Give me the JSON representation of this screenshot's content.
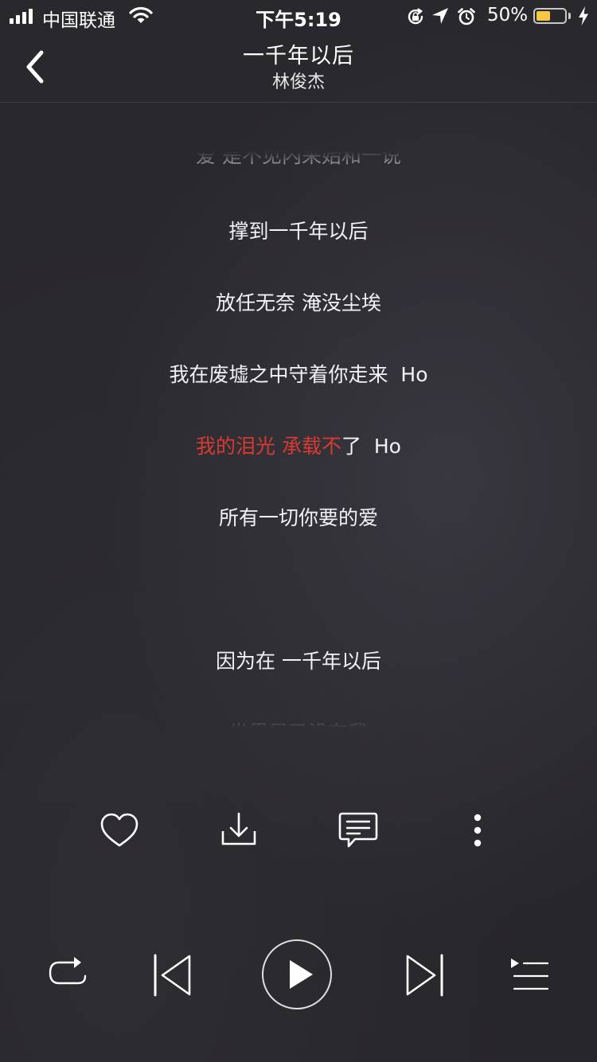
{
  "status_bar": {
    "carrier": "中国联通",
    "time": "下午5:19",
    "battery_percent": "50%",
    "battery_level": 0.5,
    "battery_color": "#f7c744",
    "icons": [
      "signal-icon",
      "wifi-icon",
      "orientation-lock-icon",
      "location-arrow-icon",
      "alarm-icon",
      "battery-icon",
      "charging-bolt-icon"
    ]
  },
  "nav": {
    "title": "一千年以后",
    "artist": "林俊杰",
    "back_icon": "chevron-left-icon"
  },
  "lyrics": {
    "lines": [
      {
        "text": "爱 是不见内采始和一说",
        "state": "partial-top"
      },
      {
        "text": "撑到一千年以后",
        "state": "normal"
      },
      {
        "text": "放任无奈 淹没尘埃",
        "state": "normal"
      },
      {
        "text": "我在废墟之中守着你走来  Ho",
        "state": "normal"
      },
      {
        "text": "我的泪光 承载不了  Ho",
        "sung": "我的泪光 承载不",
        "rest": "了  Ho",
        "state": "current"
      },
      {
        "text": "所有一切你要的爱",
        "state": "normal"
      },
      {
        "text": "",
        "state": "blank"
      },
      {
        "text": "因为在 一千年以后",
        "state": "normal"
      },
      {
        "text": "世界早已没有我",
        "state": "partial-bottom"
      }
    ],
    "highlight_color": "#d63b32"
  },
  "actions": {
    "icons": [
      "heart-icon",
      "download-icon",
      "comment-icon",
      "more-icon"
    ]
  },
  "player": {
    "state": "paused",
    "icons": [
      "repeat-icon",
      "previous-icon",
      "play-icon",
      "next-icon",
      "playlist-icon"
    ]
  }
}
